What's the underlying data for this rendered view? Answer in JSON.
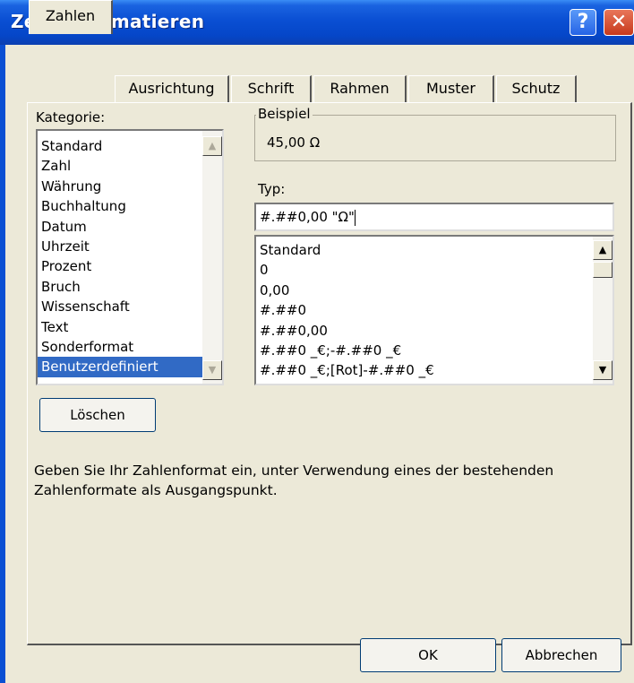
{
  "window": {
    "title": "Zellen formatieren",
    "help_glyph": "?",
    "close_glyph": "✕"
  },
  "tabs": [
    "Zahlen",
    "Ausrichtung",
    "Schrift",
    "Rahmen",
    "Muster",
    "Schutz"
  ],
  "active_tab": "Zahlen",
  "category": {
    "label": "Kategorie:",
    "items": [
      "Standard",
      "Zahl",
      "Währung",
      "Buchhaltung",
      "Datum",
      "Uhrzeit",
      "Prozent",
      "Bruch",
      "Wissenschaft",
      "Text",
      "Sonderformat",
      "Benutzerdefiniert"
    ],
    "selected": "Benutzerdefiniert"
  },
  "sample": {
    "label": "Beispiel",
    "value": "45,00 Ω"
  },
  "type": {
    "label": "Typ:",
    "value": "#.##0,00 \"Ω\"",
    "items": [
      "Standard",
      "0",
      "0,00",
      "#.##0",
      "#.##0,00",
      "#.##0 _€;-#.##0 _€",
      "#.##0 _€;[Rot]-#.##0 _€"
    ]
  },
  "buttons": {
    "delete": "Löschen",
    "ok": "OK",
    "cancel": "Abbrechen"
  },
  "hint": "Geben Sie Ihr Zahlenformat ein, unter Verwendung eines der bestehenden Zahlenformate als Ausgangspunkt.",
  "scroll": {
    "up": "▲",
    "down": "▼"
  },
  "colors": {
    "titlebar": "#0a4fd3",
    "selection": "#316ac5",
    "face": "#ece9d8"
  }
}
